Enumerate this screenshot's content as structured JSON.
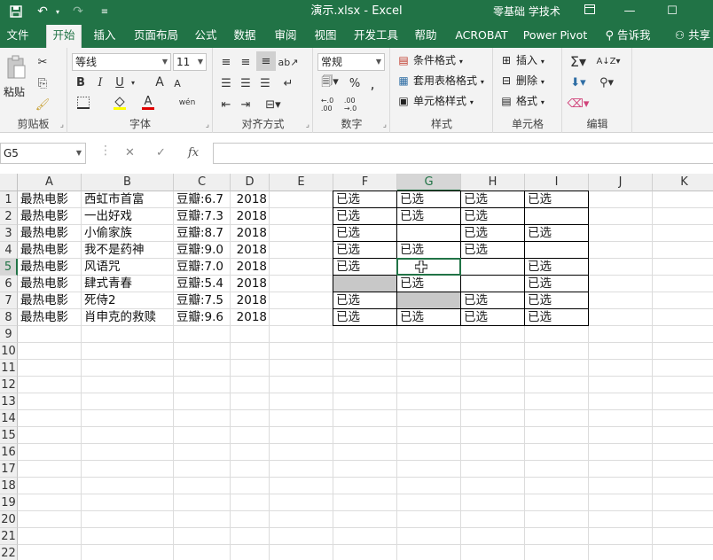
{
  "titlebar": {
    "title": "演示.xlsx  -  Excel",
    "user": "零基础 学技术",
    "save_icon": "save-icon",
    "undo_icon": "undo-icon",
    "redo_icon": "redo-icon",
    "customize_icon": "customize-qat-icon",
    "ribbon_display_icon": "ribbon-display-icon",
    "minimize": "—",
    "maximize": "☐"
  },
  "tabs": [
    "文件",
    "开始",
    "插入",
    "页面布局",
    "公式",
    "数据",
    "审阅",
    "视图",
    "开发工具",
    "帮助",
    "ACROBAT",
    "Power Pivot",
    "告诉我",
    "共享"
  ],
  "ribbon": {
    "clipboard": {
      "label": "剪贴板",
      "paste": "粘贴"
    },
    "font": {
      "label": "字体",
      "name": "等线",
      "size": "11",
      "bold": "B",
      "italic": "I",
      "underline": "U",
      "grow": "A",
      "shrink": "A",
      "phonetic": "wén"
    },
    "alignment": {
      "label": "对齐方式"
    },
    "number": {
      "label": "数字",
      "format": "常规",
      "percent": "%",
      "comma": ","
    },
    "styles": {
      "label": "样式",
      "conditional": "条件格式",
      "table": "套用表格格式",
      "cell_styles": "单元格样式"
    },
    "cells": {
      "label": "单元格",
      "insert": "插入",
      "delete": "删除",
      "format": "格式"
    },
    "editing": {
      "label": "编辑"
    }
  },
  "formula_bar": {
    "name_box": "G5",
    "cancel": "✕",
    "enter": "✓",
    "fx": "fx",
    "content": ""
  },
  "columns": [
    "A",
    "B",
    "C",
    "D",
    "E",
    "F",
    "G",
    "H",
    "I",
    "J",
    "K"
  ],
  "selected_column": "G",
  "selected_row": 5,
  "rows": [
    "1",
    "2",
    "3",
    "4",
    "5",
    "6",
    "7",
    "8",
    "9",
    "10",
    "11",
    "12",
    "13",
    "14",
    "15",
    "16",
    "17",
    "18",
    "19",
    "20",
    "21",
    "22"
  ],
  "table": [
    {
      "a": "最热电影",
      "b": "西虹市首富",
      "c": "豆瓣:6.7",
      "d": "2018",
      "f": "已选",
      "g": "已选",
      "h": "已选",
      "i": "已选"
    },
    {
      "a": "最热电影",
      "b": "一出好戏",
      "c": "豆瓣:7.3",
      "d": "2018",
      "f": "已选",
      "g": "已选",
      "h": "已选",
      "i": ""
    },
    {
      "a": "最热电影",
      "b": "小偷家族",
      "c": "豆瓣:8.7",
      "d": "2018",
      "f": "已选",
      "g": "",
      "h": "已选",
      "i": "已选"
    },
    {
      "a": "最热电影",
      "b": "我不是药神",
      "c": "豆瓣:9.0",
      "d": "2018",
      "f": "已选",
      "g": "已选",
      "h": "已选",
      "i": ""
    },
    {
      "a": "最热电影",
      "b": "风语咒",
      "c": "豆瓣:7.0",
      "d": "2018",
      "f": "已选",
      "g": "",
      "h": "",
      "i": "已选"
    },
    {
      "a": "最热电影",
      "b": "肆式青春",
      "c": "豆瓣:5.4",
      "d": "2018",
      "f": "",
      "g": "已选",
      "h": "",
      "i": "已选"
    },
    {
      "a": "最热电影",
      "b": "死侍2",
      "c": "豆瓣:7.5",
      "d": "2018",
      "f": "已选",
      "g": "",
      "h": "已选",
      "i": "已选"
    },
    {
      "a": "最热电影",
      "b": "肖申克的救赎",
      "c": "豆瓣:9.6",
      "d": "2018",
      "f": "已选",
      "g": "已选",
      "h": "已选",
      "i": "已选"
    }
  ],
  "gray_cells": [
    "F6",
    "G7"
  ],
  "colors": {
    "excel_green": "#217346",
    "gray_fill": "#c8c8c8"
  }
}
